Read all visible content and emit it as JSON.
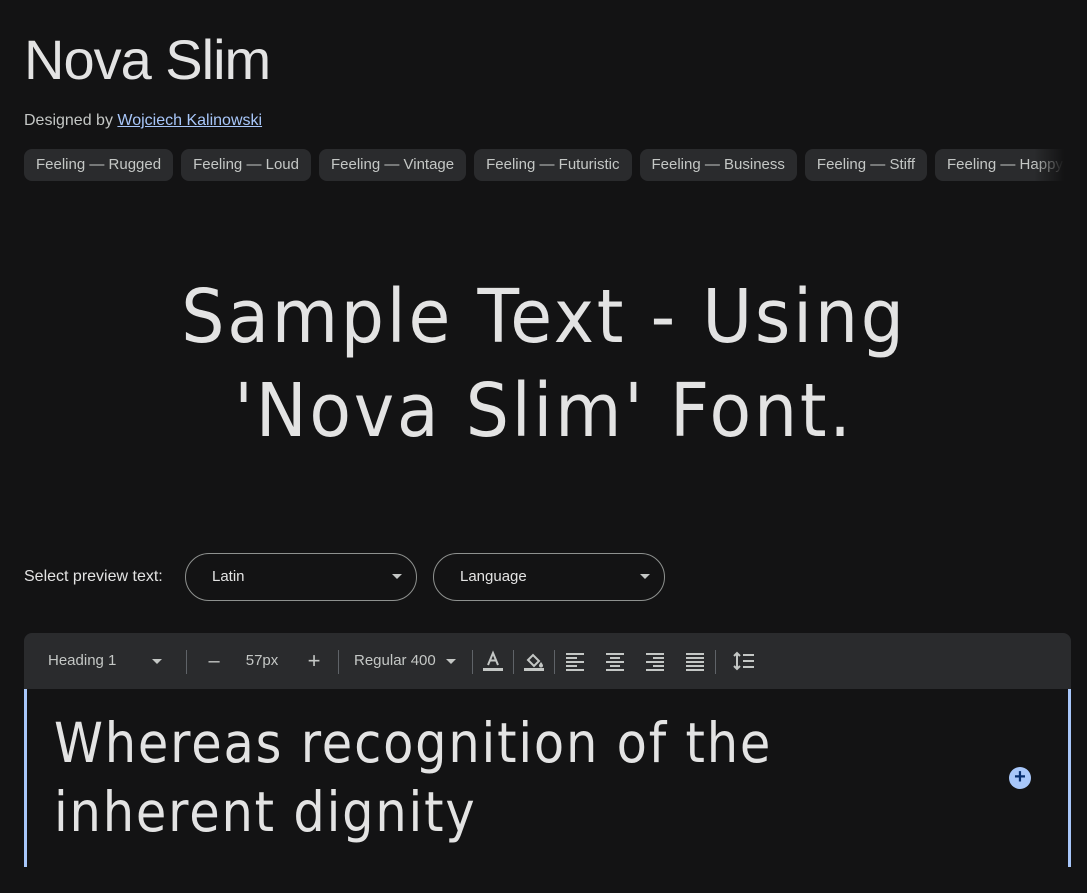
{
  "font": {
    "name": "Nova Slim",
    "designed_by_label": "Designed by",
    "designer": "Wojciech Kalinowski"
  },
  "feelings": [
    "Feeling — Rugged",
    "Feeling — Loud",
    "Feeling — Vintage",
    "Feeling — Futuristic",
    "Feeling — Business",
    "Feeling — Stiff",
    "Feeling — Happy"
  ],
  "sample_text": "Sample Text - Using 'Nova Slim' Font.",
  "preview": {
    "label": "Select preview text:",
    "script_value": "Latin",
    "language_value": "Language"
  },
  "toolbar": {
    "style_value": "Heading 1",
    "decrease_label": "–",
    "size_value": "57px",
    "increase_label": "+",
    "weight_value": "Regular 400"
  },
  "editor": {
    "text": "Whereas recognition of the inherent dignity",
    "add_label": "+"
  },
  "colors": {
    "background": "#131314",
    "accent": "#a8c7fa",
    "chip_bg": "#2a2b2d"
  }
}
